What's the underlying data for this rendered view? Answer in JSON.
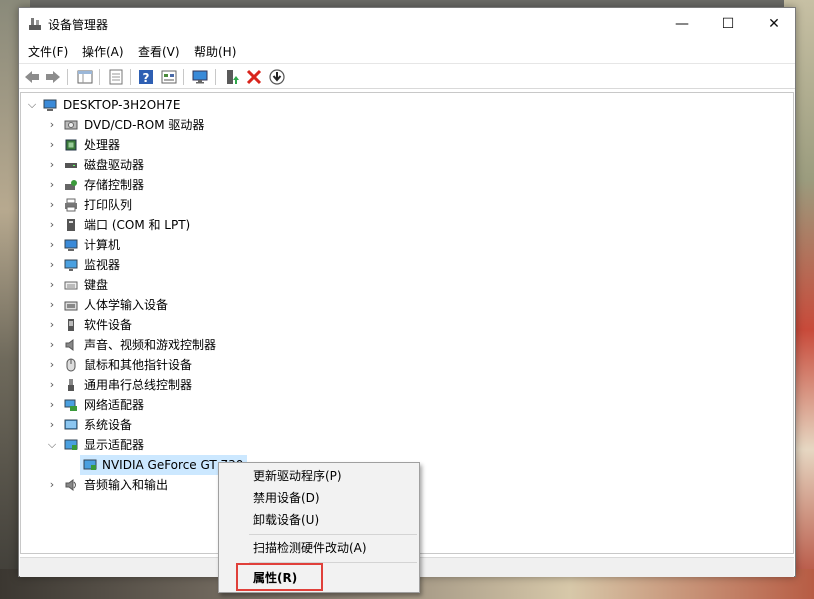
{
  "window": {
    "title": "设备管理器",
    "minimize_glyph": "—",
    "maximize_glyph": "☐",
    "close_glyph": "✕"
  },
  "menu": [
    "文件(F)",
    "操作(A)",
    "查看(V)",
    "帮助(H)"
  ],
  "toolbar_icons": [
    "back-arrow-icon",
    "forward-arrow-icon",
    "properties-grid-icon",
    "document-icon",
    "help-icon",
    "view-icon",
    "monitor-icon",
    "update-driver-icon",
    "uninstall-x-icon",
    "download-icon"
  ],
  "tree": {
    "root": "DESKTOP-3H2OH7E",
    "categories": [
      {
        "label": "DVD/CD-ROM 驱动器",
        "icon": "dvd-drive-icon"
      },
      {
        "label": "处理器",
        "icon": "processor-icon"
      },
      {
        "label": "磁盘驱动器",
        "icon": "disk-drive-icon"
      },
      {
        "label": "存储控制器",
        "icon": "storage-controller-icon"
      },
      {
        "label": "打印队列",
        "icon": "printer-icon"
      },
      {
        "label": "端口 (COM 和 LPT)",
        "icon": "port-icon"
      },
      {
        "label": "计算机",
        "icon": "computer-icon"
      },
      {
        "label": "监视器",
        "icon": "monitor-icon"
      },
      {
        "label": "键盘",
        "icon": "keyboard-icon"
      },
      {
        "label": "人体学输入设备",
        "icon": "hid-icon"
      },
      {
        "label": "软件设备",
        "icon": "software-device-icon"
      },
      {
        "label": "声音、视频和游戏控制器",
        "icon": "speaker-icon"
      },
      {
        "label": "鼠标和其他指针设备",
        "icon": "mouse-icon"
      },
      {
        "label": "通用串行总线控制器",
        "icon": "usb-icon"
      },
      {
        "label": "网络适配器",
        "icon": "network-adapter-icon"
      },
      {
        "label": "系统设备",
        "icon": "system-device-icon"
      },
      {
        "label": "显示适配器",
        "icon": "display-adapter-icon",
        "expanded": true
      },
      {
        "label": "音频输入和输出",
        "icon": "audio-io-icon"
      }
    ],
    "display_child": "NVIDIA GeForce GT 730"
  },
  "context_menu": {
    "update_driver": "更新驱动程序(P)",
    "disable_device": "禁用设备(D)",
    "uninstall_device": "卸载设备(U)",
    "scan_hardware": "扫描检测硬件改动(A)",
    "properties": "属性(R)"
  },
  "colors": {
    "selection": "#cce8ff",
    "highlight_box": "#e0403a",
    "help_blue": "#2e5fb3",
    "uninstall_red": "#d9241c"
  }
}
